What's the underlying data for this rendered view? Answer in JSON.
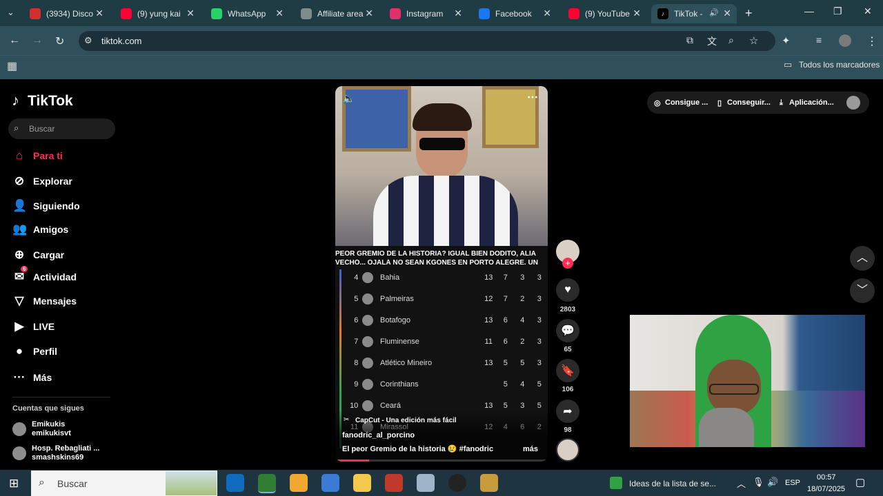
{
  "browser": {
    "tabs": [
      {
        "title": "(3934) Disco",
        "icon": "discord-icon",
        "color": "#d32f2f"
      },
      {
        "title": "(9) yung kai",
        "icon": "youtube-icon",
        "color": "#ff0033"
      },
      {
        "title": "WhatsApp",
        "icon": "whatsapp-icon",
        "color": "#25d366"
      },
      {
        "title": "Affiliate area",
        "icon": "globe-icon",
        "color": "#7f8c8d"
      },
      {
        "title": "Instagram",
        "icon": "instagram-icon",
        "color": "#e1306c"
      },
      {
        "title": "Facebook",
        "icon": "facebook-icon",
        "color": "#1877f2"
      },
      {
        "title": "(9) YouTube",
        "icon": "youtube-icon",
        "color": "#ff0033"
      },
      {
        "title": "TikTok -",
        "icon": "tiktok-icon",
        "color": "#000000"
      }
    ],
    "url": "tiktok.com",
    "bookmarks_label": "Todos los marcadores"
  },
  "tiktok": {
    "logo": "TikTok",
    "search_placeholder": "Buscar",
    "nav": [
      {
        "label": "Para ti",
        "icon": "home-icon",
        "active": true
      },
      {
        "label": "Explorar",
        "icon": "compass-icon"
      },
      {
        "label": "Siguiendo",
        "icon": "user-follow-icon"
      },
      {
        "label": "Amigos",
        "icon": "friends-icon"
      },
      {
        "label": "Cargar",
        "icon": "upload-icon"
      },
      {
        "label": "Actividad",
        "icon": "inbox-icon",
        "badge": "6"
      },
      {
        "label": "Mensajes",
        "icon": "send-icon"
      },
      {
        "label": "LIVE",
        "icon": "live-icon"
      },
      {
        "label": "Perfil",
        "icon": "avatar-icon"
      },
      {
        "label": "Más",
        "icon": "more-dots-icon"
      }
    ],
    "following_title": "Cuentas que sigues",
    "following": [
      {
        "name": "Emikukis",
        "handle": "emikukisvt"
      },
      {
        "name": "Hosp. Rebagliati ...",
        "handle": "smashskins69"
      }
    ],
    "top_actions": [
      "Consigue ...",
      "Conseguir...",
      "Aplicación..."
    ],
    "video": {
      "caption_line1": "PEOR GREMIO DE LA HISTORIA? IGUAL BIEN DODITO, ALIA",
      "caption_line2": "VECHÓ... OJALÁ NO SEAN KGONES EN PORTO ALEGRE. UN",
      "table": [
        {
          "pos": "4",
          "team": "Bahia",
          "a": "13",
          "b": "7",
          "c": "3",
          "d": "3"
        },
        {
          "pos": "5",
          "team": "Palmeiras",
          "a": "12",
          "b": "7",
          "c": "2",
          "d": "3"
        },
        {
          "pos": "6",
          "team": "Botafogo",
          "a": "13",
          "b": "6",
          "c": "4",
          "d": "3"
        },
        {
          "pos": "7",
          "team": "Fluminense",
          "a": "11",
          "b": "6",
          "c": "2",
          "d": "3"
        },
        {
          "pos": "8",
          "team": "Atlético Mineiro",
          "a": "13",
          "b": "5",
          "c": "5",
          "d": "3"
        },
        {
          "pos": "9",
          "team": "Corinthians",
          "a": "",
          "b": "5",
          "c": "4",
          "d": "5"
        },
        {
          "pos": "10",
          "team": "Ceará",
          "a": "13",
          "b": "5",
          "c": "3",
          "d": "5"
        },
        {
          "pos": "11",
          "team": "Mirassol",
          "a": "12",
          "b": "4",
          "c": "6",
          "d": "2"
        }
      ],
      "capcut": "CapCut - Una edición más fácil",
      "author": "fanodric_al_porcino",
      "description": "El peor Gremio de la historia 😢 #fanodric ...",
      "more": "más",
      "likes": "2803",
      "comments": "65",
      "saves": "106",
      "shares": "98"
    }
  },
  "taskbar": {
    "search_placeholder": "Buscar",
    "widget_text": "Ideas de la lista de se...",
    "lang": "ESP",
    "time": "00:57",
    "date": "18/07/2025"
  }
}
